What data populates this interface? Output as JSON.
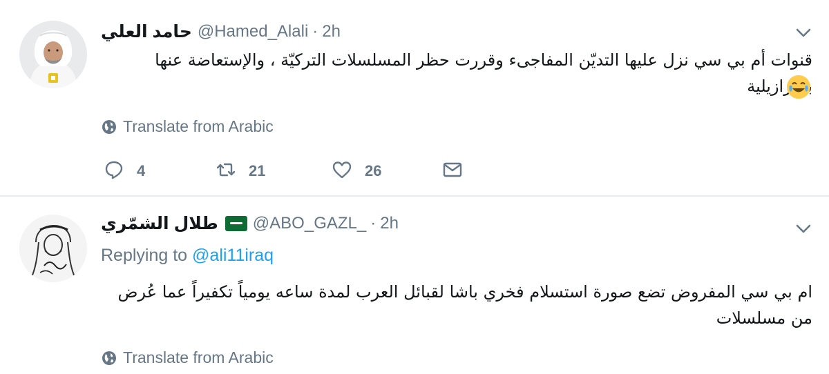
{
  "tweets": [
    {
      "name": "حامد العلي",
      "handle": "@Hamed_Alali",
      "separator": "·",
      "time": "2h",
      "text": "قنوات أم بي سي نزل عليها التديّن المفاجىء وقررت حظر المسلسلات التركيّة ، والإستعاضة عنها بالبرازيلية",
      "emoji": "joy-face-icon",
      "translate": "Translate from Arabic",
      "replies": "4",
      "retweets": "21",
      "likes": "26"
    },
    {
      "name": "طلال الشمّري",
      "flag": "saudi-flag-icon",
      "handle": "@ABO_GAZL_",
      "separator": "·",
      "time": "2h",
      "replying_prefix": "Replying to",
      "replying_to": "@ali11iraq",
      "text": "ام بي سي المفروض تضع صورة استسلام فخري باشا لقبائل العرب لمدة ساعه يومياً تكفيراً عما عُرض من مسلسلات",
      "translate": "Translate from Arabic"
    }
  ],
  "colors": {
    "primary_text": "#14171a",
    "secondary_text": "#657786",
    "link": "#1da1f2",
    "divider": "#e6ecf0"
  }
}
